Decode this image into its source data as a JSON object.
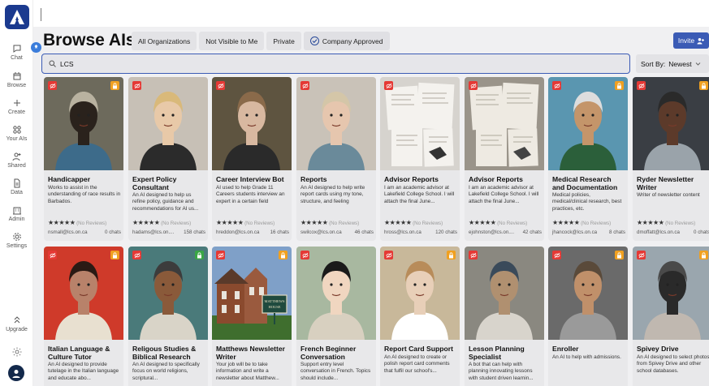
{
  "sidebar": {
    "items": [
      {
        "label": "Chat",
        "icon": "chat-icon"
      },
      {
        "label": "Browse",
        "icon": "browse-icon"
      },
      {
        "label": "Create",
        "icon": "plus-icon"
      },
      {
        "label": "Your AIs",
        "icon": "grid-icon"
      },
      {
        "label": "Shared",
        "icon": "shared-users-icon"
      },
      {
        "label": "Data",
        "icon": "document-icon"
      },
      {
        "label": "Admin",
        "icon": "building-icon"
      },
      {
        "label": "Settings",
        "icon": "gear-icon"
      }
    ],
    "upgrade_label": "Upgrade"
  },
  "header": {
    "title": "Browse AIs",
    "filters": [
      "All Organizations",
      "Not Visible to Me",
      "Private",
      "Company Approved"
    ],
    "invite_label": "Invite"
  },
  "search": {
    "value": "LCS",
    "placeholder": ""
  },
  "sort": {
    "label": "Sort By:",
    "value": "Newest"
  },
  "cards": [
    {
      "name": "Handicapper",
      "desc": "Works to assist in the understanding of race results in Barbados.",
      "rating": "★★★★★",
      "reviews": "(No Reviews)",
      "owner": "nsmall@lcs.on.ca",
      "chats": "0 chats",
      "lock": true
    },
    {
      "name": "Expert Policy Consultant",
      "desc": "An AI designed to help us refine policy, guidance and recommendations for AI us...",
      "rating": "★★★★★",
      "reviews": "(No Reviews)",
      "owner": "hadams@lcs.on....",
      "chats": "158 chats",
      "lock": false
    },
    {
      "name": "Career Interview Bot",
      "desc": "AI used to help Grade 11 Careers students interview an expert in a certain field",
      "rating": "★★★★★",
      "reviews": "(No Reviews)",
      "owner": "hreddon@lcs.on.ca",
      "chats": "16 chats",
      "lock": false
    },
    {
      "name": "Reports",
      "desc": "An AI designed to help write report cards using my tone, structure, and feeling",
      "rating": "★★★★★",
      "reviews": "(No Reviews)",
      "owner": "swilcox@lcs.on.ca",
      "chats": "46 chats",
      "lock": false
    },
    {
      "name": "Advisor Reports",
      "desc": "I am an academic advisor at Lakefield College School. I will attach the final June...",
      "rating": "★★★★★",
      "reviews": "(No Reviews)",
      "owner": "hross@lcs.on.ca",
      "chats": "120 chats",
      "lock": false
    },
    {
      "name": "Advisor Reports",
      "desc": "I am an academic advisor at Lakefield College School. I will attach the final June...",
      "rating": "★★★★★",
      "reviews": "(No Reviews)",
      "owner": "ejohnston@lcs.on....",
      "chats": "42 chats",
      "lock": false
    },
    {
      "name": "Medical Research and Documentation",
      "desc": "Medical policies, medical/clinical research, best practices, etc.",
      "rating": "★★★★★",
      "reviews": "(No Reviews)",
      "owner": "jhancock@lcs.on.ca",
      "chats": "8 chats",
      "lock": true
    },
    {
      "name": "Ryder Newsletter Writer",
      "desc": "Writer of newsletter content",
      "rating": "★★★★★",
      "reviews": "(No Reviews)",
      "owner": "dmoffatt@lcs.on.ca",
      "chats": "0 chats",
      "lock": true
    },
    {
      "name": "Italian Language & Culture Tutor",
      "desc": "An AI designed to provide tutelage in the Italian language and educate abo...",
      "lock": true
    },
    {
      "name": "Religous Studies & Biblical Research",
      "desc": "An AI designed to specifically focus on world religions, scriptural...",
      "lock": true,
      "green": true
    },
    {
      "name": "Matthews Newsletter Writer",
      "desc": "Your job will be to take information and write a newsletter about Matthew...",
      "lock": true
    },
    {
      "name": "French Beginner Conversation",
      "desc": "Support entry level conversation in French. Topics should include...",
      "lock": false
    },
    {
      "name": "Report Card Support",
      "desc": "An AI designed to create or polish report card comments that fulfil our school's...",
      "lock": true
    },
    {
      "name": "Lesson Planning Specialist",
      "desc": "A bot that can help with planning innovating lessons with student driven learnin...",
      "lock": false
    },
    {
      "name": "Enroller",
      "desc": "An AI to help with admissions.",
      "lock": true
    },
    {
      "name": "Spivey Drive",
      "desc": "An AI designed to select photos from Spivey Drive and other school databases.",
      "lock": true
    }
  ],
  "sign": {
    "line1": "MATTHEWS",
    "line2": "HOUSE"
  },
  "colors": {
    "accent": "#3b5bb5",
    "lock_badge": "#f0a020",
    "hidden_badge": "#e53935"
  }
}
